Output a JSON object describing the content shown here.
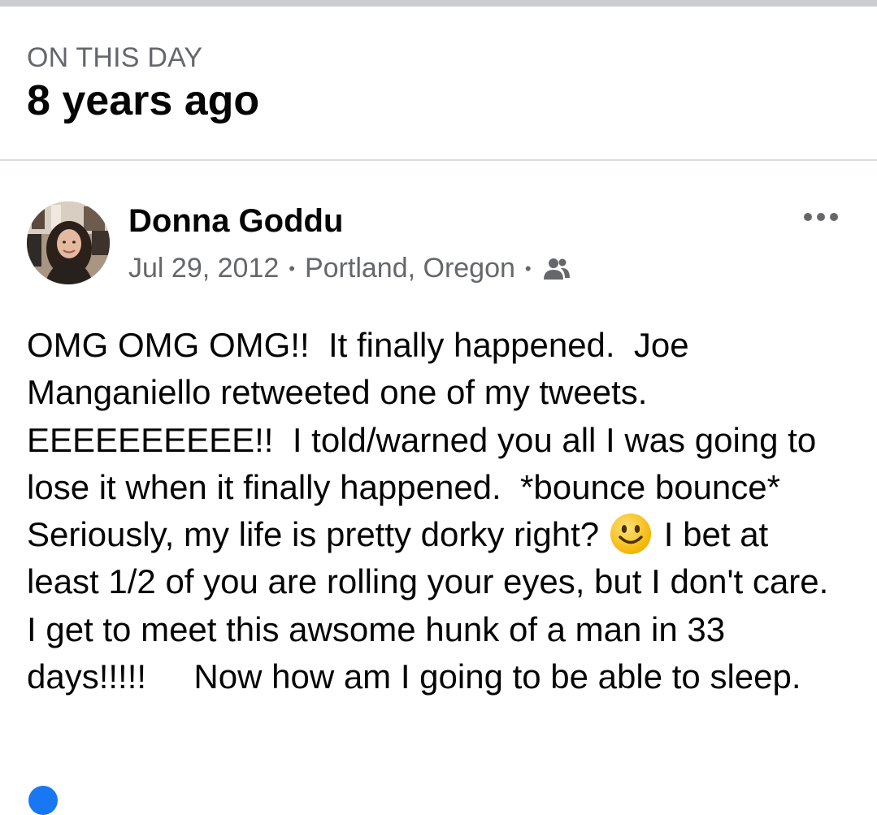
{
  "memory": {
    "label": "ON THIS DAY",
    "title": "8 years ago"
  },
  "post": {
    "author": "Donna Goddu",
    "date": "Jul 29, 2012",
    "location": "Portland, Oregon",
    "separator": "•",
    "audience_icon": "friends-icon",
    "more_icon": "more-options-icon",
    "text_before_emoji": "OMG OMG OMG!!  It finally happened.  Joe Manganiello retweeted one of my tweets. EEEEEEEEEE!!  I told/warned you all I was going to lose it when it finally happened.  *bounce bounce*  Seriously, my life is pretty dorky right? ",
    "emoji": "smiley-emoji",
    "text_after_emoji": "I bet at least 1/2 of you are rolling your eyes, but I don't care.  I get to meet this awsome hunk of a man in 33 days!!!!!     Now how am I going to be able to sleep."
  },
  "colors": {
    "primary_text": "#050505",
    "secondary_text": "#65676b",
    "divider": "#dadde1",
    "accent": "#1877f2"
  }
}
